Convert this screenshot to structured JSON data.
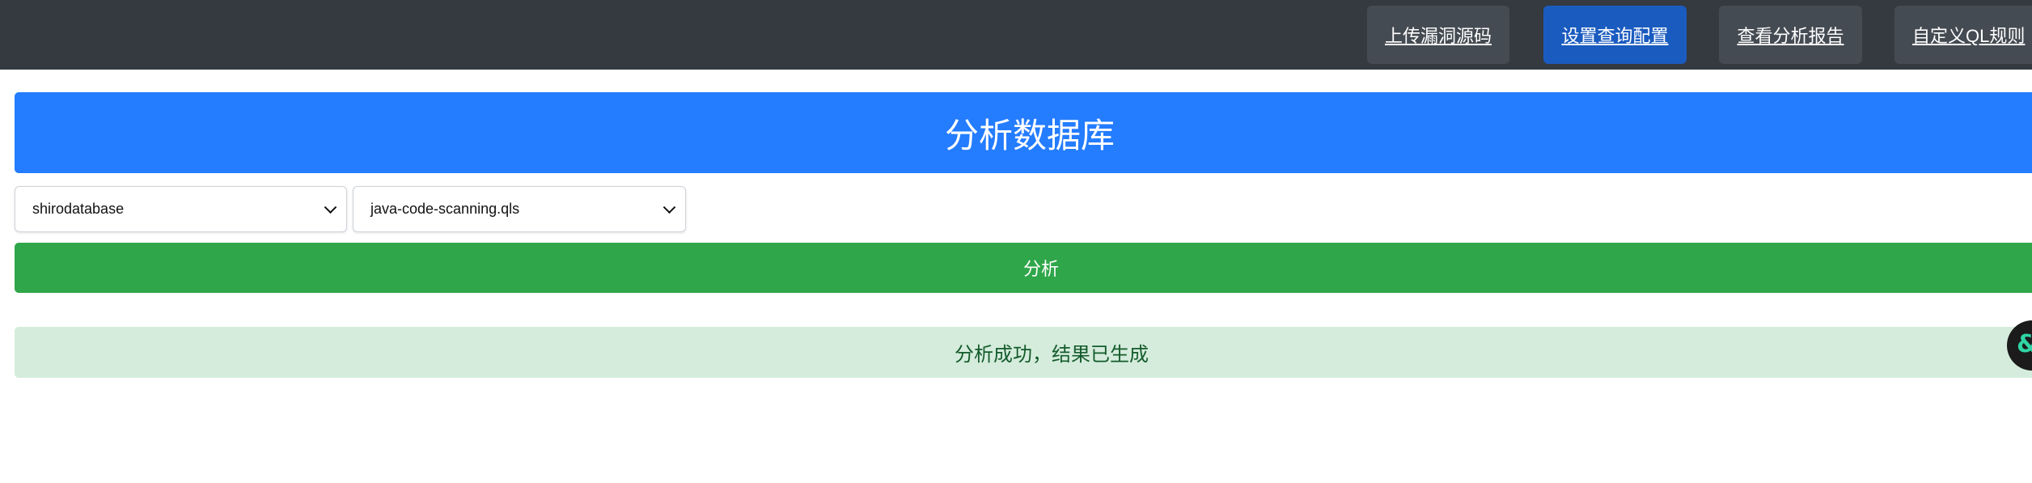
{
  "nav": {
    "items": [
      {
        "label": "上传漏洞源码",
        "active": false
      },
      {
        "label": "设置查询配置",
        "active": true
      },
      {
        "label": "查看分析报告",
        "active": false
      },
      {
        "label": "自定义QL规则",
        "active": false
      }
    ]
  },
  "main": {
    "title": "分析数据库",
    "database_select": {
      "value": "shirodatabase"
    },
    "query_select": {
      "value": "java-code-scanning.qls"
    },
    "analyze_label": "分析",
    "alert_message": "分析成功，结果已生成"
  },
  "widget": {
    "icon": "floating-assistant-icon",
    "color": "#2fd5a5"
  },
  "colors": {
    "topbar": "#343a40",
    "nav_active": "#1a5bbf",
    "banner": "#247cff",
    "analyze": "#30a64a",
    "alert_bg": "#d5ecdc",
    "alert_text": "#145b2c"
  }
}
